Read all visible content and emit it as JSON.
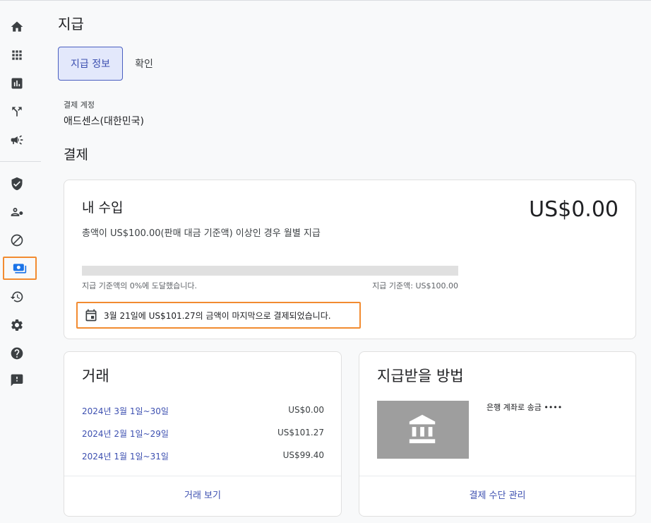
{
  "sidebar": {
    "items": [
      {
        "name": "home-icon"
      },
      {
        "name": "apps-icon"
      },
      {
        "name": "reports-icon"
      },
      {
        "name": "optimization-icon"
      },
      {
        "name": "campaign-icon"
      },
      {
        "name": "brand-safety-icon"
      },
      {
        "name": "account-access-icon"
      },
      {
        "name": "blocking-icon"
      },
      {
        "name": "payments-icon",
        "active": true
      },
      {
        "name": "history-icon"
      },
      {
        "name": "settings-icon"
      },
      {
        "name": "help-icon"
      },
      {
        "name": "feedback-icon"
      }
    ]
  },
  "page": {
    "title": "지급",
    "tabs": [
      {
        "label": "지급 정보",
        "selected": true
      },
      {
        "label": "확인",
        "selected": false
      }
    ],
    "account_label": "결제 계정",
    "account_value": "애드센스(대한민국)",
    "section_title": "결제"
  },
  "earnings": {
    "title": "내 수입",
    "amount": "US$0.00",
    "description": "총액이 US$100.00(판매 대금 기준액) 이상인 경우 월별 지급",
    "progress_fraction": 0,
    "progress_left": "지급 기준액의 0%에 도달했습니다.",
    "progress_right": "지급 기준액: US$100.00",
    "last_payment": "3월 21일에 US$101.27의 금액이 마지막으로 결제되었습니다."
  },
  "transactions": {
    "title": "거래",
    "rows": [
      {
        "date": "2024년 3월 1일~30일",
        "amount": "US$0.00"
      },
      {
        "date": "2024년 2월 1일~29일",
        "amount": "US$101.27"
      },
      {
        "date": "2024년 1월 1일~31일",
        "amount": "US$99.40"
      }
    ],
    "link": "거래 보기"
  },
  "payment_method": {
    "title": "지급받을 방법",
    "text": "은행 계좌로 송금 •••• ",
    "link": "결제 수단 관리"
  },
  "colors": {
    "accent": "#1a73e8",
    "link": "#3c4fb0",
    "highlight": "#f28b30"
  }
}
